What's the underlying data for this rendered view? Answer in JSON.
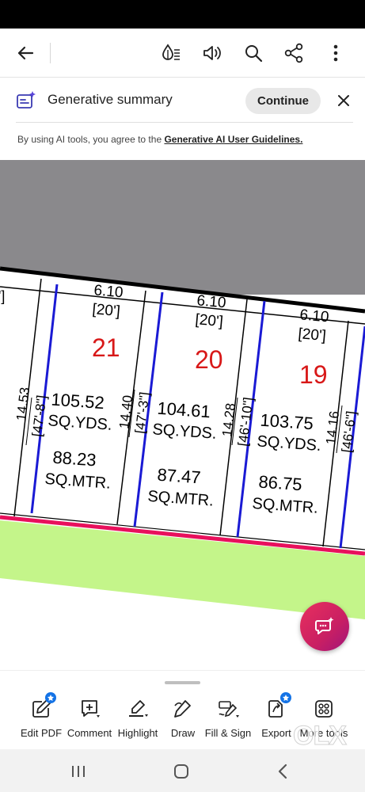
{
  "toolbar": {
    "icons": [
      "back-arrow-icon",
      "reading-mode-icon",
      "read-aloud-icon",
      "search-icon",
      "share-icon",
      "more-vertical-icon"
    ]
  },
  "generative_banner": {
    "title": "Generative summary",
    "continue_label": "Continue",
    "note_prefix": "By using AI tools, you agree to the ",
    "note_link": "Generative AI User Guidelines."
  },
  "document": {
    "plots": [
      {
        "number": "21",
        "frontage_m": "6.10",
        "frontage_ft": "[20']",
        "depth_m": "14.40",
        "depth_ft": "[47'-3\"]",
        "area_yds": "105.52",
        "area_yds_unit": "SQ.YDS.",
        "area_mtr": "88.23",
        "area_mtr_unit": "SQ.MTR."
      },
      {
        "number": "20",
        "frontage_m": "6.10",
        "frontage_ft": "[20']",
        "depth_m": "14.28",
        "depth_ft": "[46'-10\"]",
        "area_yds": "104.61",
        "area_yds_unit": "SQ.YDS.",
        "area_mtr": "87.47",
        "area_mtr_unit": "SQ.MTR."
      },
      {
        "number": "19",
        "frontage_m": "6.10",
        "frontage_ft": "[20']",
        "depth_m": "14.16",
        "depth_ft": "[46'-6\"]",
        "area_yds": "103.75",
        "area_yds_unit": "SQ.YDS.",
        "area_mtr": "86.75",
        "area_mtr_unit": "SQ.MTR."
      }
    ],
    "left_plot_depth_m": "14.53",
    "left_plot_depth_ft": "[47'-8\"]",
    "colors": {
      "gray_area": "#8a898c",
      "road": "#c4f58a",
      "boundary_red": "#e8105c",
      "plot_line_blue": "#1a1ad4"
    }
  },
  "bottom_tools": [
    {
      "label": "Edit PDF",
      "icon": "edit-pdf-icon",
      "badge": true
    },
    {
      "label": "Comment",
      "icon": "comment-icon",
      "badge": false
    },
    {
      "label": "Highlight",
      "icon": "highlight-icon",
      "badge": false
    },
    {
      "label": "Draw",
      "icon": "draw-icon",
      "badge": false
    },
    {
      "label": "Fill & Sign",
      "icon": "fill-sign-icon",
      "badge": false
    },
    {
      "label": "Export",
      "icon": "export-icon",
      "badge": true
    },
    {
      "label": "More tools",
      "icon": "more-tools-icon",
      "badge": false
    }
  ],
  "watermark": "OLX",
  "nav": [
    "recent-apps-icon",
    "home-icon",
    "back-icon"
  ]
}
